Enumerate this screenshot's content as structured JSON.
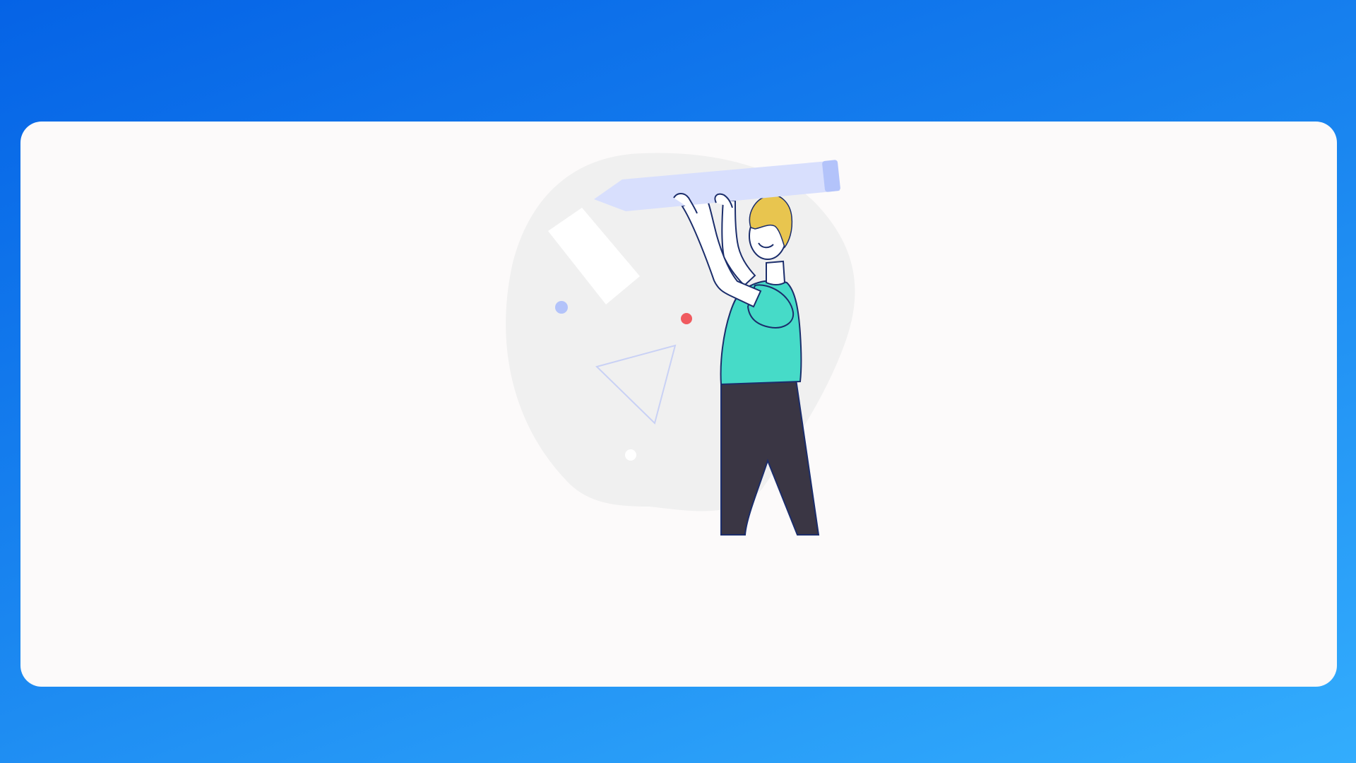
{
  "screen": {
    "title": "",
    "illustration": {
      "subject": "person-holding-pencil",
      "icon_names": [
        "pencil-icon",
        "rectangle-shape",
        "triangle-shape",
        "dot-shape"
      ]
    }
  },
  "colors": {
    "background_start": "#0563e6",
    "background_end": "#33adfd",
    "card": "#fcfafa",
    "blob": "#f0f0f0",
    "pencil_body": "#d8dffd",
    "pencil_cap": "#b3c3fa",
    "hair": "#e8c54f",
    "shirt": "#46dbc8",
    "pants": "#3a3644",
    "outline": "#1b2d6b",
    "dot_blue": "#b3c3fa",
    "dot_red": "#f05a5f",
    "white": "#ffffff"
  }
}
